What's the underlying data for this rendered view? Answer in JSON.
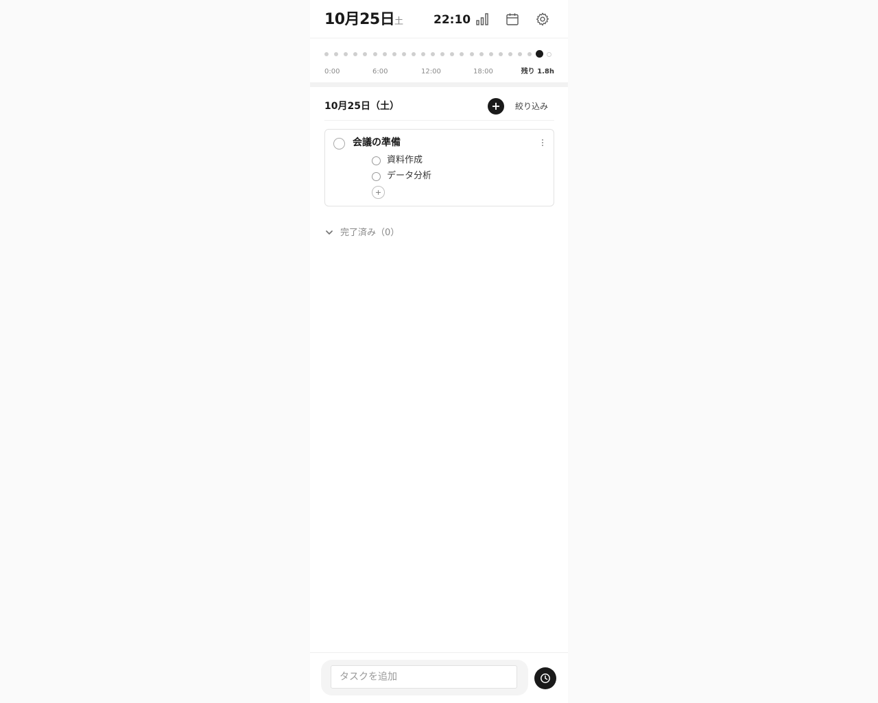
{
  "header": {
    "date": "10月25日",
    "weekday": "土",
    "time": "22:10",
    "icons": [
      "bar-chart-icon",
      "calendar-icon",
      "gear-icon"
    ]
  },
  "timeline": {
    "hours_total": 24,
    "current_hour": 22,
    "tick_labels": [
      "0:00",
      "6:00",
      "12:00",
      "18:00"
    ],
    "remaining": "残り 1.8h"
  },
  "section": {
    "title": "10月25日（土）",
    "add_label": "+",
    "filter_label": "絞り込み"
  },
  "tasks": [
    {
      "title": "会議の準備",
      "subtasks": [
        "資料作成",
        "データ分析"
      ]
    }
  ],
  "completed": {
    "label": "完了済み（0）"
  },
  "bottom": {
    "input_placeholder": "タスクを追加",
    "clock_icon": "clock-icon"
  },
  "colors": {
    "accent": "#1a1a1a",
    "muted": "#8a8a8a",
    "dot": "#cfcfcf"
  }
}
